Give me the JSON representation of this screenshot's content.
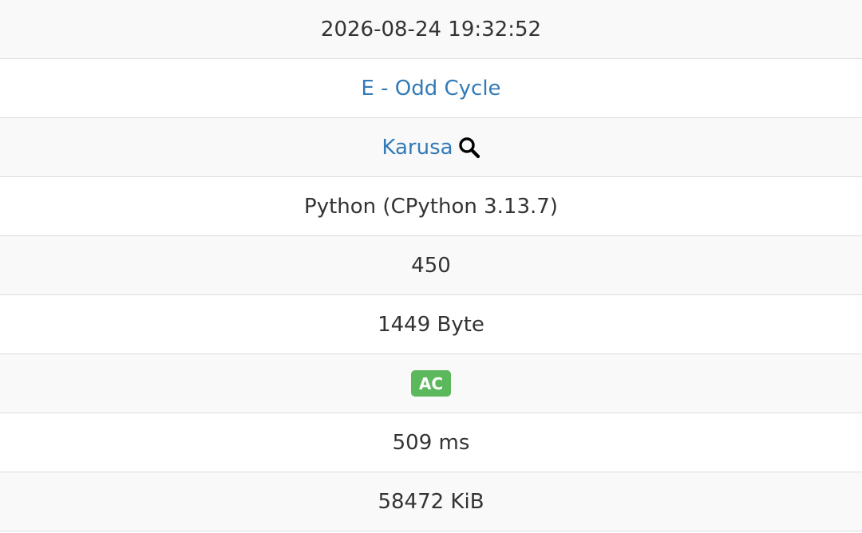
{
  "submission": {
    "submitted_at": "2026-08-24 19:32:52",
    "task": "E - Odd Cycle",
    "user": "Karusa",
    "user_search_icon": "search-icon",
    "language": "Python (CPython 3.13.7)",
    "score": "450",
    "code_size": "1449 Byte",
    "status": "AC",
    "exec_time": "509 ms",
    "memory": "58472 KiB"
  },
  "colors": {
    "link": "#337ab7",
    "status_ac": "#5cb85c",
    "row_stripe": "#f9f9f9",
    "border": "#dddddd"
  }
}
